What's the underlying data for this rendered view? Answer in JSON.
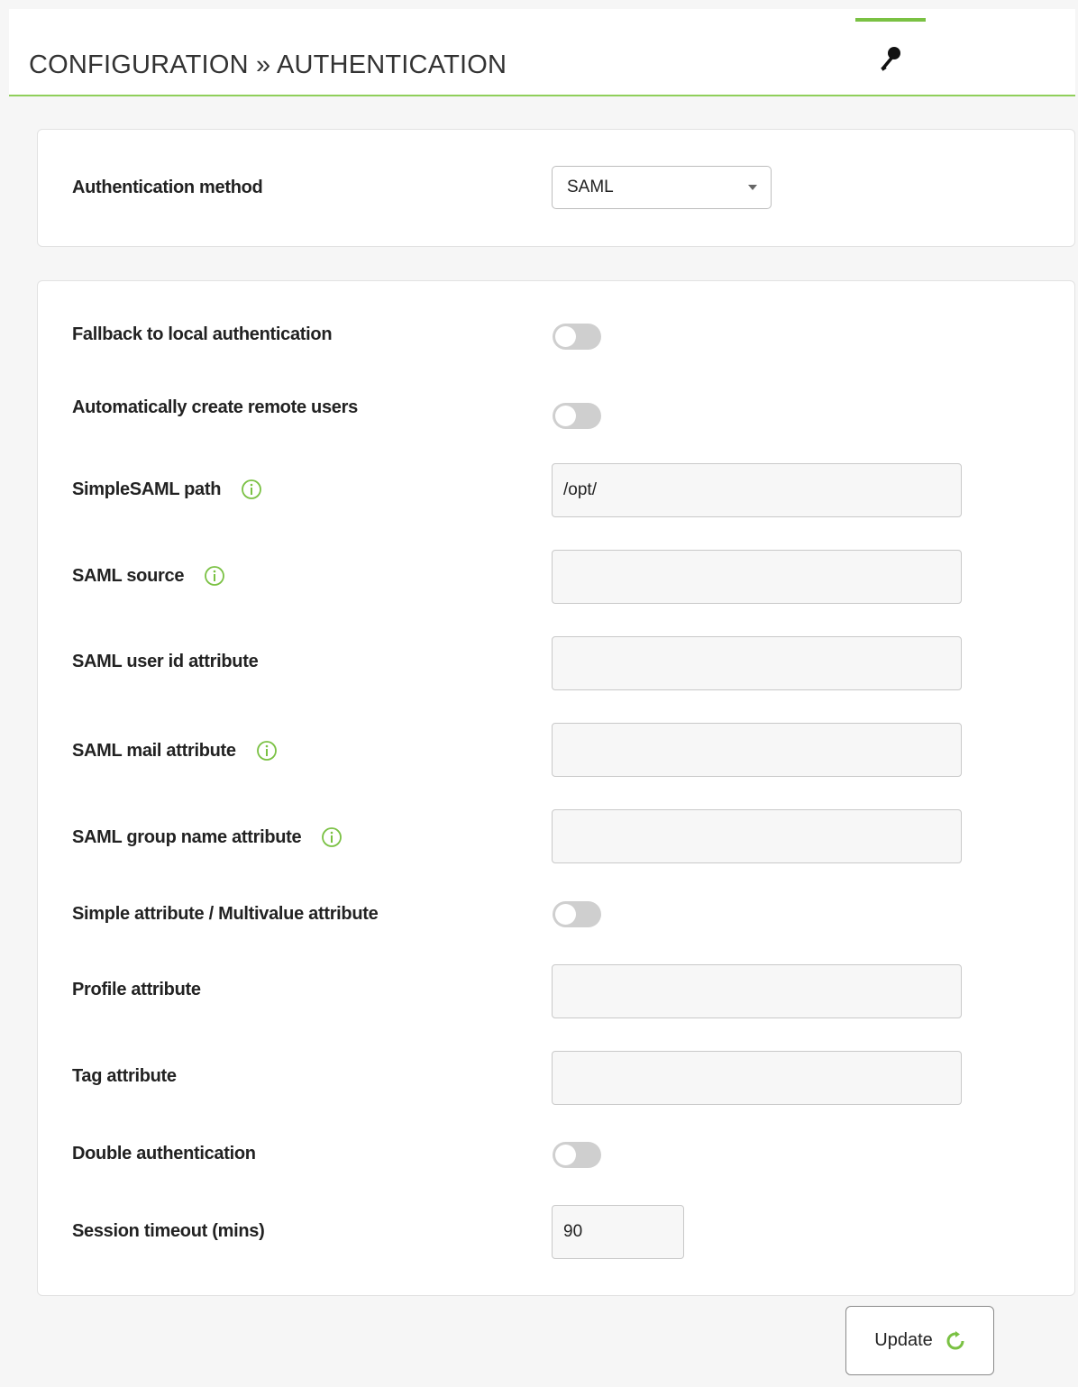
{
  "header": {
    "title": "CONFIGURATION » AUTHENTICATION",
    "tab_icon": "key-icon"
  },
  "colors": {
    "accent": "#7ac143",
    "header_border": "#8fcf5a",
    "toggle_off": "#cfcfcf"
  },
  "method": {
    "label": "Authentication method",
    "selected": "SAML"
  },
  "settings": {
    "fallback": {
      "label": "Fallback to local authentication",
      "enabled": false
    },
    "auto_create": {
      "label": "Automatically create remote users",
      "enabled": false
    },
    "simplesaml_path": {
      "label": "SimpleSAML path",
      "value": "/opt/",
      "has_info": true
    },
    "saml_source": {
      "label": "SAML source",
      "value": "",
      "has_info": true
    },
    "user_id_attr": {
      "label": "SAML user id attribute",
      "value": ""
    },
    "mail_attr": {
      "label": "SAML mail attribute",
      "value": "",
      "has_info": true
    },
    "group_attr": {
      "label": "SAML group name attribute",
      "value": "",
      "has_info": true
    },
    "multivalue": {
      "label": "Simple attribute / Multivalue attribute",
      "enabled": false
    },
    "profile_attr": {
      "label": "Profile attribute",
      "value": ""
    },
    "tag_attr": {
      "label": "Tag attribute",
      "value": ""
    },
    "double_auth": {
      "label": "Double authentication",
      "enabled": false
    },
    "session_timeout": {
      "label": "Session timeout (mins)",
      "value": "90"
    }
  },
  "actions": {
    "update_label": "Update",
    "update_icon": "refresh-icon"
  }
}
